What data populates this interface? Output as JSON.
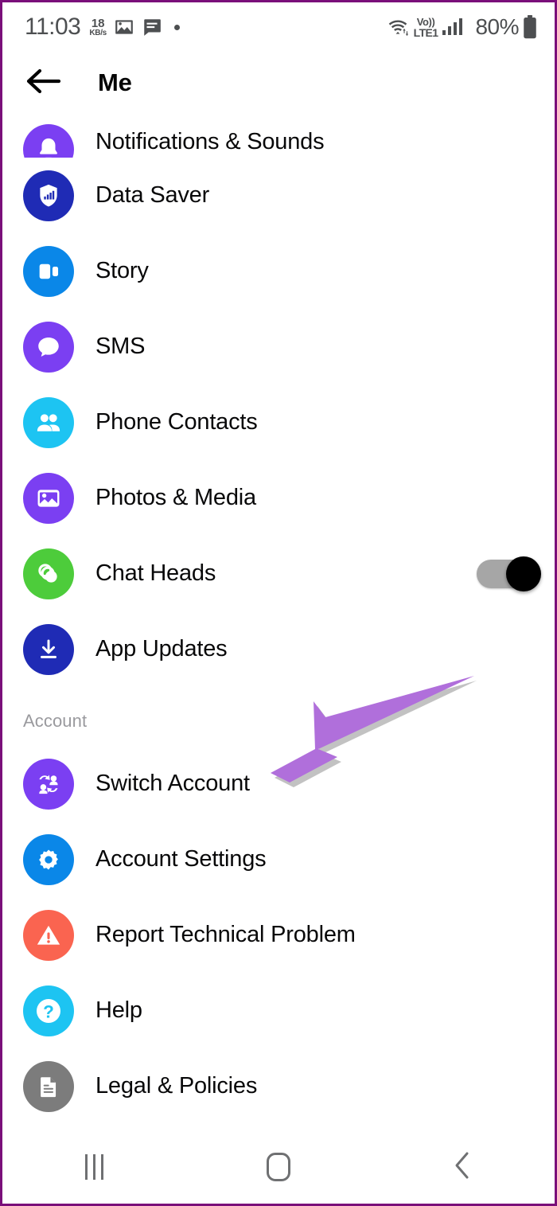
{
  "status_bar": {
    "clock": "11:03",
    "net_speed_value": "18",
    "net_speed_unit": "KB/s",
    "icons": [
      "photo-icon",
      "message-icon",
      "dot-indicator"
    ],
    "volte_top": "Vo))",
    "volte_bottom": "LTE1",
    "battery_percent": "80%",
    "text_color": "#4d4f51"
  },
  "app_bar": {
    "back_icon": "back-arrow-icon",
    "title": "Me"
  },
  "list": {
    "items": [
      {
        "label": "Notifications & Sounds",
        "icon": "bell-icon",
        "color": "#7b3ff2",
        "clipped": true,
        "has_toggle": false
      },
      {
        "label": "Data Saver",
        "icon": "shield-signal-icon",
        "color": "#1f2bb5",
        "clipped": false,
        "has_toggle": false
      },
      {
        "label": "Story",
        "icon": "story-cards-icon",
        "color": "#0a87e8",
        "clipped": false,
        "has_toggle": false
      },
      {
        "label": "SMS",
        "icon": "speech-bubble-icon",
        "color": "#7b3ff2",
        "clipped": false,
        "has_toggle": false
      },
      {
        "label": "Phone Contacts",
        "icon": "people-icon",
        "color": "#1dc4f2",
        "clipped": false,
        "has_toggle": false
      },
      {
        "label": "Photos & Media",
        "icon": "photo-icon",
        "color": "#7b3ff2",
        "clipped": false,
        "has_toggle": false
      },
      {
        "label": "Chat Heads",
        "icon": "chat-heads-icon",
        "color": "#4dcc3b",
        "clipped": false,
        "has_toggle": true,
        "toggle_state": "on"
      },
      {
        "label": "App Updates",
        "icon": "download-icon",
        "color": "#1f2bb5",
        "clipped": false,
        "has_toggle": false
      }
    ]
  },
  "account_section": {
    "header": "Account",
    "items": [
      {
        "label": "Switch Account",
        "icon": "switch-account-icon",
        "color": "#7b3ff2"
      },
      {
        "label": "Account Settings",
        "icon": "gear-icon",
        "color": "#0a87e8"
      },
      {
        "label": "Report Technical Problem",
        "icon": "warning-triangle-icon",
        "color": "#fa6450"
      },
      {
        "label": "Help",
        "icon": "question-mark-icon",
        "color": "#1dc4f2"
      },
      {
        "label": "Legal & Policies",
        "icon": "document-icon",
        "color": "#7c7c7c"
      }
    ]
  },
  "annotation": {
    "arrow_icon": "annotation-arrow-icon",
    "color": "#b06fdb",
    "points_at": "Switch Account"
  },
  "nav_bar": {
    "recents_icon": "recents-icon",
    "home_icon": "home-icon",
    "back_icon": "nav-back-icon",
    "color": "#6f7072"
  },
  "frame": {
    "border_color": "#7a0f7a"
  }
}
